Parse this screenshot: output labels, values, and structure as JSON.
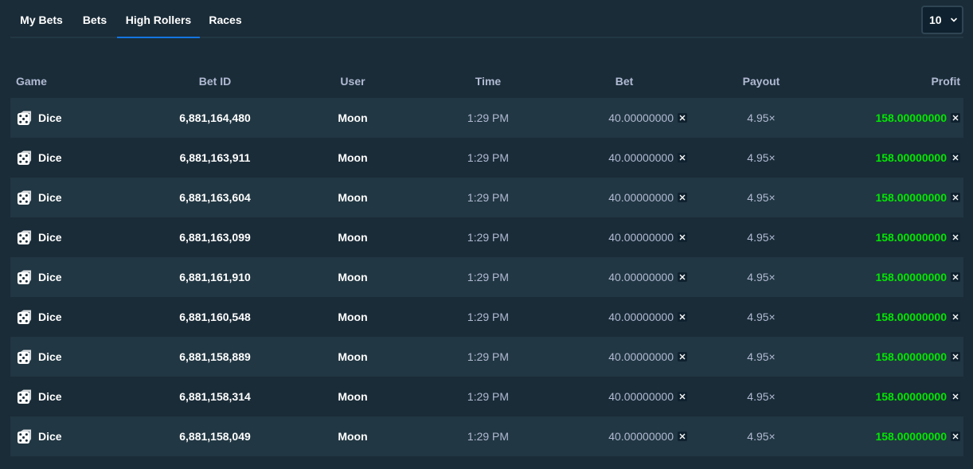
{
  "tabs": [
    {
      "label": "My Bets",
      "active": false
    },
    {
      "label": "Bets",
      "active": false
    },
    {
      "label": "High Rollers",
      "active": true
    },
    {
      "label": "Races",
      "active": false
    }
  ],
  "page_size": {
    "value": "10"
  },
  "table": {
    "headers": {
      "game": "Game",
      "bet_id": "Bet ID",
      "user": "User",
      "time": "Time",
      "bet": "Bet",
      "payout": "Payout",
      "profit": "Profit"
    },
    "rows": [
      {
        "game": "Dice",
        "bet_id": "6,881,164,480",
        "user": "Moon",
        "time": "1:29 PM",
        "bet": "40.00000000",
        "payout": "4.95×",
        "profit": "158.00000000"
      },
      {
        "game": "Dice",
        "bet_id": "6,881,163,911",
        "user": "Moon",
        "time": "1:29 PM",
        "bet": "40.00000000",
        "payout": "4.95×",
        "profit": "158.00000000"
      },
      {
        "game": "Dice",
        "bet_id": "6,881,163,604",
        "user": "Moon",
        "time": "1:29 PM",
        "bet": "40.00000000",
        "payout": "4.95×",
        "profit": "158.00000000"
      },
      {
        "game": "Dice",
        "bet_id": "6,881,163,099",
        "user": "Moon",
        "time": "1:29 PM",
        "bet": "40.00000000",
        "payout": "4.95×",
        "profit": "158.00000000"
      },
      {
        "game": "Dice",
        "bet_id": "6,881,161,910",
        "user": "Moon",
        "time": "1:29 PM",
        "bet": "40.00000000",
        "payout": "4.95×",
        "profit": "158.00000000"
      },
      {
        "game": "Dice",
        "bet_id": "6,881,160,548",
        "user": "Moon",
        "time": "1:29 PM",
        "bet": "40.00000000",
        "payout": "4.95×",
        "profit": "158.00000000"
      },
      {
        "game": "Dice",
        "bet_id": "6,881,158,889",
        "user": "Moon",
        "time": "1:29 PM",
        "bet": "40.00000000",
        "payout": "4.95×",
        "profit": "158.00000000"
      },
      {
        "game": "Dice",
        "bet_id": "6,881,158,314",
        "user": "Moon",
        "time": "1:29 PM",
        "bet": "40.00000000",
        "payout": "4.95×",
        "profit": "158.00000000"
      },
      {
        "game": "Dice",
        "bet_id": "6,881,158,049",
        "user": "Moon",
        "time": "1:29 PM",
        "bet": "40.00000000",
        "payout": "4.95×",
        "profit": "158.00000000"
      }
    ]
  },
  "icons": {
    "game": "dice-icon",
    "currency": "currency-x-icon",
    "dropdown": "chevron-down-icon"
  },
  "colors": {
    "background": "#1a2c38",
    "row_alt": "#213743",
    "accent": "#1475e1",
    "profit": "#00e701",
    "muted": "#b1bad3"
  }
}
